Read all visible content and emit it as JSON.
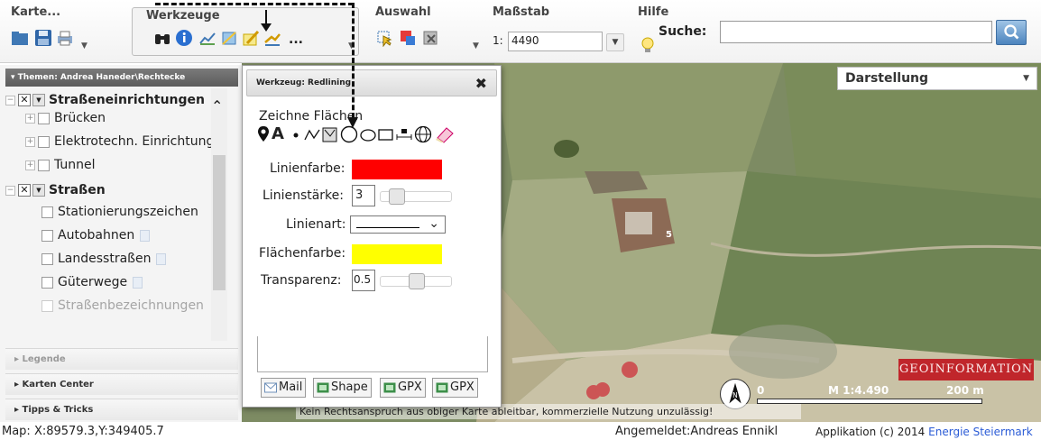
{
  "toolbar": {
    "karte_label": "Karte...",
    "werkzeuge_label": "Werkzeuge",
    "auswahl_label": "Auswahl",
    "massstab_label": "Maßstab",
    "hilfe_label": "Hilfe",
    "more_label": "...",
    "scale_prefix": "1:",
    "scale_value": "4490",
    "search_label": "Suche:",
    "search_value": ""
  },
  "left_panel": {
    "themen_header": "▾ Themen: Andrea Haneder\\Rechtecke",
    "tree": [
      {
        "label": "Straßeneinrichtungen",
        "level": 0
      },
      {
        "label": "Brücken",
        "level": 1
      },
      {
        "label": "Elektrotechn. Einrichtungen",
        "level": 1
      },
      {
        "label": "Tunnel",
        "level": 1
      },
      {
        "label": "Straßen",
        "level": 0
      },
      {
        "label": "Stationierungszeichen",
        "level": 1
      },
      {
        "label": "Autobahnen",
        "level": 1
      },
      {
        "label": "Landesstraßen",
        "level": 1
      },
      {
        "label": "Güterwege",
        "level": 1
      },
      {
        "label": "Straßenbezeichnungen",
        "level": 1
      }
    ],
    "accordion": {
      "legende": "▸ Legende",
      "karten_center": "▸ Karten Center",
      "tipps": "▸ Tipps & Tricks"
    }
  },
  "dialog": {
    "title": "Werkzeug: Redlining",
    "close": "✖",
    "draw_label": "Zeichne Flächen",
    "line_color_label": "Linienfarbe:",
    "line_color": "#ff0000",
    "line_width_label": "Linienstärke:",
    "line_width": "3",
    "line_style_label": "Linienart:",
    "fill_color_label": "Flächenfarbe:",
    "fill_color": "#ffff00",
    "transparency_label": "Transparenz:",
    "transparency": "0.5",
    "export_buttons": [
      "Mail",
      "Shape",
      "GPX",
      "GPX"
    ]
  },
  "map": {
    "darstellung": "Darstellung",
    "geo_banner": "GEOINFORMATION",
    "scale_zero": "0",
    "scale_ratio": "M 1:4.490",
    "scale_distance": "200 m",
    "north": "N",
    "disclaimer": "Kein Rechtsanspruch aus obiger Karte ableitbar, kommerzielle Nutzung unzulässig!",
    "marker_5": "5"
  },
  "statusbar": {
    "coords": "Map: X:89579.3,Y:349405.7",
    "logged_in": "Angemeldet:Andreas Ennikl",
    "app_credit": "Applikation (c) 2014",
    "app_credit_link": "Energie Steiermark"
  }
}
